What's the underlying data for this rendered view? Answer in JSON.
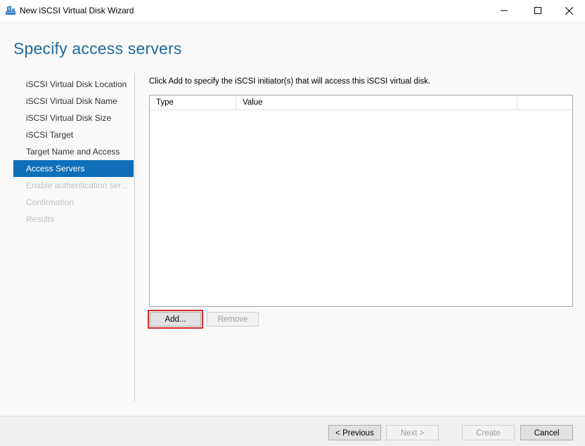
{
  "window": {
    "title": "New iSCSI Virtual Disk Wizard",
    "controls": {
      "minimize": "minimize",
      "maximize": "maximize",
      "close": "close"
    }
  },
  "page": {
    "title": "Specify access servers",
    "instruction": "Click Add to specify the iSCSI initiator(s) that will access this iSCSI virtual disk."
  },
  "nav": {
    "items": [
      {
        "label": "iSCSI Virtual Disk Location",
        "state": "normal"
      },
      {
        "label": "iSCSI Virtual Disk Name",
        "state": "normal"
      },
      {
        "label": "iSCSI Virtual Disk Size",
        "state": "normal"
      },
      {
        "label": "iSCSI Target",
        "state": "normal"
      },
      {
        "label": "Target Name and Access",
        "state": "normal"
      },
      {
        "label": "Access Servers",
        "state": "active"
      },
      {
        "label": "Enable authentication ser...",
        "state": "disabled"
      },
      {
        "label": "Confirmation",
        "state": "disabled"
      },
      {
        "label": "Results",
        "state": "disabled"
      }
    ]
  },
  "list": {
    "columns": [
      "Type",
      "Value"
    ],
    "rows": []
  },
  "buttons": {
    "add": "Add...",
    "remove": "Remove",
    "previous": "< Previous",
    "next": "Next >",
    "create": "Create",
    "cancel": "Cancel"
  },
  "colors": {
    "title": "#1e6a9a",
    "nav_active_bg": "#0f6fb8",
    "highlight_outline": "#d32a2a"
  }
}
